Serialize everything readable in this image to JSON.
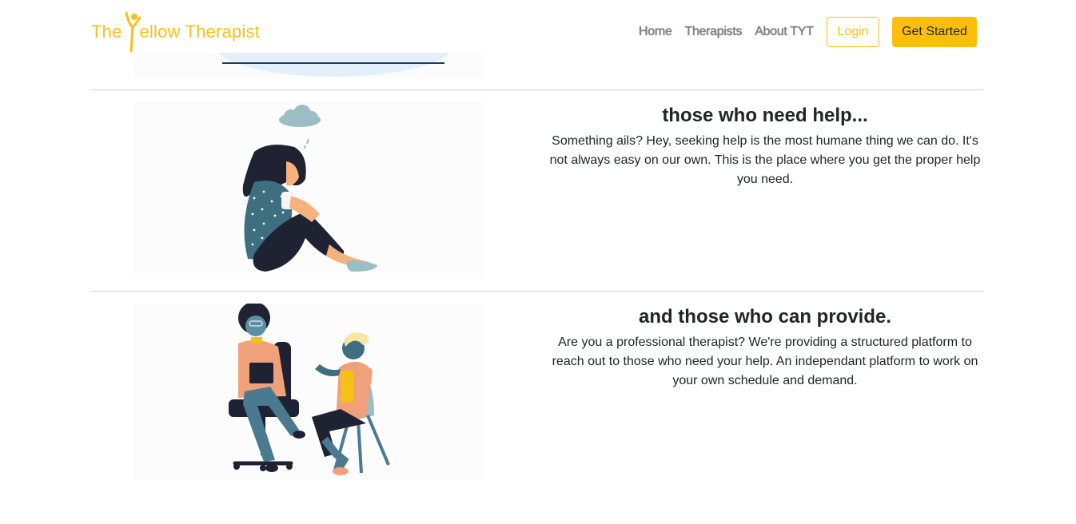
{
  "brand": {
    "prefix": "The",
    "rest": "ellow Therapist",
    "color": "#f6c114"
  },
  "nav": {
    "links": [
      "Home",
      "Therapists",
      "About TYT"
    ],
    "login_label": "Login",
    "get_started_label": "Get Started"
  },
  "sections": [
    {
      "title": "those who need help...",
      "body": "Something ails? Hey, seeking help is the most humane thing we can do. It's not always easy on our own. This is the place where you get the proper help you need.",
      "illustration": "person-sitting-sad-illustration"
    },
    {
      "title": "and those who can provide.",
      "body": "Are you a professional therapist? We're providing a structured platform to reach out to those who need your help. An independant platform to work on your own schedule and demand.",
      "illustration": "therapy-session-illustration"
    }
  ],
  "colors": {
    "accent": "#fcbf08",
    "divider": "#cfd2d5"
  }
}
